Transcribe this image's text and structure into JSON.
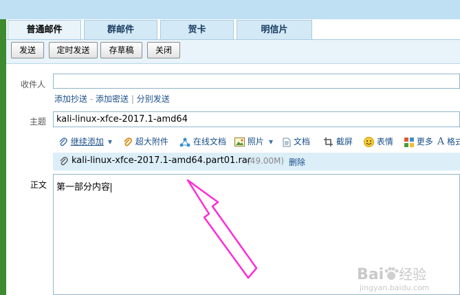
{
  "tabs": [
    "普通邮件",
    "群邮件",
    "贺卡",
    "明信片"
  ],
  "actions": {
    "send": "发送",
    "scheduled_send": "定时发送",
    "save_draft": "存草稿",
    "close": "关闭"
  },
  "form": {
    "recipient_label": "收件人",
    "cc": "添加抄送",
    "dash": "-",
    "bcc": "添加密送",
    "pipe": "|",
    "separate": "分别发送",
    "subject_label": "主题",
    "subject_value": "kali-linux-xfce-2017.1-amd64",
    "body_label": "正文",
    "body_text": "第一部分内容"
  },
  "attach_toolbar": {
    "continue_add": "继续添加",
    "large_attachment": "超大附件",
    "online_docs": "在线文档",
    "photos": "照片",
    "docs": "文档",
    "screenshot": "截屏",
    "emoji": "表情",
    "more": "更多",
    "format": "格式"
  },
  "attachment": {
    "filename": "kali-linux-xfce-2017.1-amd64.part01.rar",
    "size": "(49.00M)",
    "delete": "删除"
  },
  "watermark": {
    "brand": "Bai",
    "brand_cn": "经验",
    "url": "jingyan.baidu.com"
  },
  "colors": {
    "arrow": "#ff2bd6",
    "link": "#1a4f8a"
  }
}
